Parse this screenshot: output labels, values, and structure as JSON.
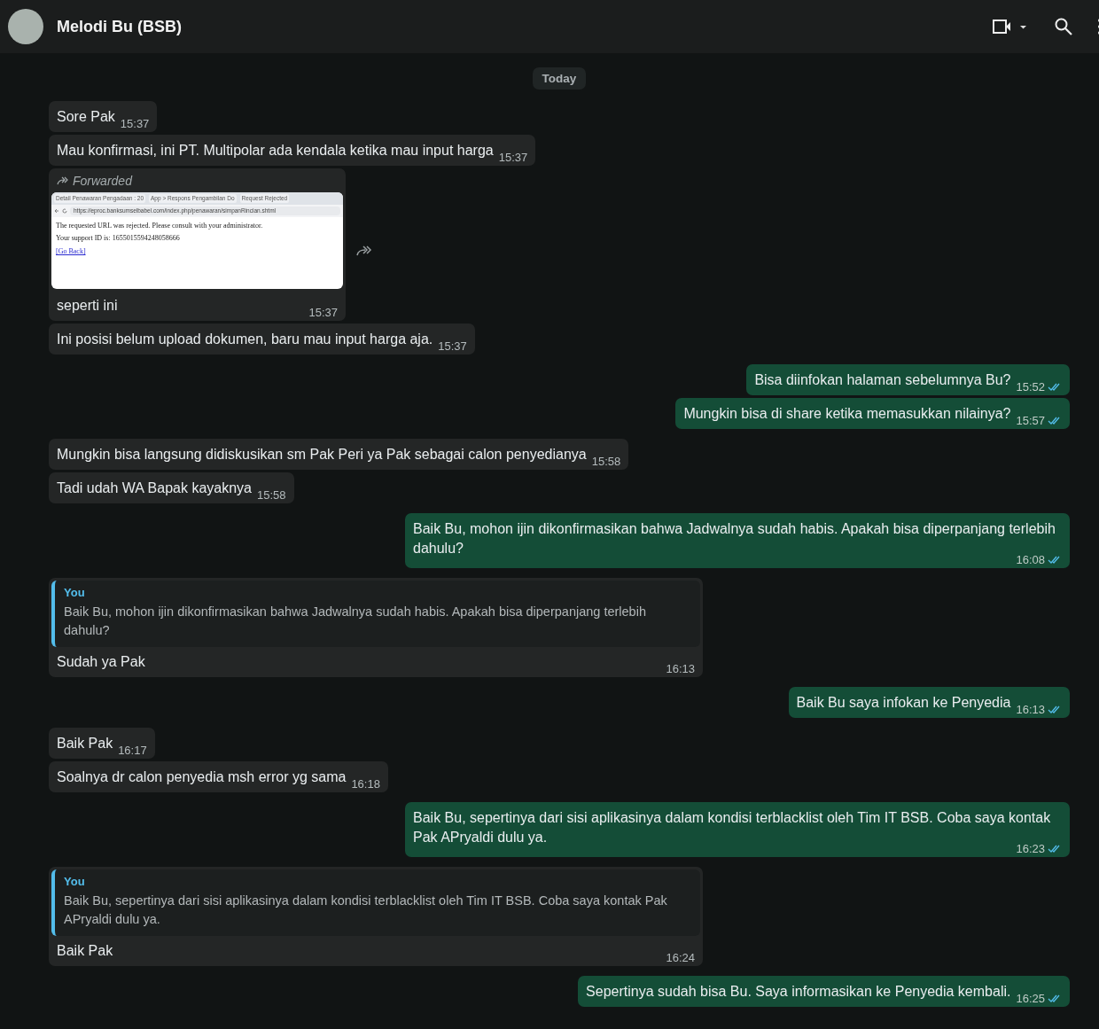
{
  "header": {
    "contact_name": "Melodi Bu (BSB)"
  },
  "date_chip": "Today",
  "messages": [
    {
      "kind": "text",
      "outgoing": false,
      "text": "Sore Pak",
      "time": "15:37"
    },
    {
      "kind": "text",
      "outgoing": false,
      "text": "Mau konfirmasi, ini PT. Multipolar ada kendala ketika mau input harga",
      "time": "15:37"
    },
    {
      "kind": "forwarded_image",
      "outgoing": false,
      "forwarded_label": "Forwarded",
      "caption": "seperti ini",
      "time": "15:37",
      "screenshot": {
        "tabs": [
          "Detail Penawaran Pengadaan : 20",
          "App > Respons Pengambilan Do",
          "Request Rejected"
        ],
        "url": "https://eproc.banksumselbabel.com/index.php/penawaran/simpanRincian.shtml",
        "lines": [
          "The requested URL was rejected. Please consult with your administrator.",
          "Your support ID is: 1655015594248058666"
        ],
        "link": "[Go Back]"
      }
    },
    {
      "kind": "text",
      "outgoing": false,
      "text": "Ini posisi belum upload dokumen, baru mau input harga aja.",
      "time": "15:37"
    },
    {
      "kind": "text",
      "outgoing": true,
      "text": "Bisa diinfokan halaman sebelumnya Bu?",
      "time": "15:52",
      "read": true
    },
    {
      "kind": "text",
      "outgoing": true,
      "text": "Mungkin bisa di share ketika memasukkan nilainya?",
      "time": "15:57",
      "read": true
    },
    {
      "kind": "text",
      "outgoing": false,
      "text": "Mungkin bisa langsung didiskusikan sm Pak Peri ya Pak sebagai calon penyedianya",
      "time": "15:58"
    },
    {
      "kind": "text",
      "outgoing": false,
      "text": "Tadi udah WA Bapak kayaknya",
      "time": "15:58"
    },
    {
      "kind": "text",
      "outgoing": true,
      "text": "Baik Bu, mohon ijin dikonfirmasikan bahwa Jadwalnya sudah habis. Apakah bisa diperpanjang terlebih dahulu?",
      "time": "16:08",
      "read": true
    },
    {
      "kind": "reply",
      "outgoing": false,
      "quote_author": "You",
      "quote_text": "Baik Bu, mohon ijin dikonfirmasikan bahwa Jadwalnya sudah habis. Apakah bisa diperpanjang terlebih dahulu?",
      "text": "Sudah ya Pak",
      "time": "16:13"
    },
    {
      "kind": "text",
      "outgoing": true,
      "text": "Baik Bu saya infokan ke Penyedia",
      "time": "16:13",
      "read": true
    },
    {
      "kind": "text",
      "outgoing": false,
      "text": "Baik Pak",
      "time": "16:17"
    },
    {
      "kind": "text",
      "outgoing": false,
      "text": "Soalnya dr calon penyedia msh error yg sama",
      "time": "16:18"
    },
    {
      "kind": "text",
      "outgoing": true,
      "text": "Baik Bu, sepertinya dari sisi aplikasinya dalam kondisi terblacklist oleh Tim IT BSB. Coba saya kontak Pak APryaldi dulu ya.",
      "time": "16:23",
      "read": true
    },
    {
      "kind": "reply",
      "outgoing": false,
      "quote_author": "You",
      "quote_text": "Baik Bu, sepertinya dari sisi aplikasinya dalam kondisi terblacklist oleh Tim IT BSB. Coba saya kontak Pak APryaldi dulu ya.",
      "text": "Baik Pak",
      "time": "16:24"
    },
    {
      "kind": "text",
      "outgoing": true,
      "text": "Sepertinya sudah bisa Bu. Saya informasikan ke Penyedia kembali.",
      "time": "16:25",
      "read": true
    }
  ]
}
